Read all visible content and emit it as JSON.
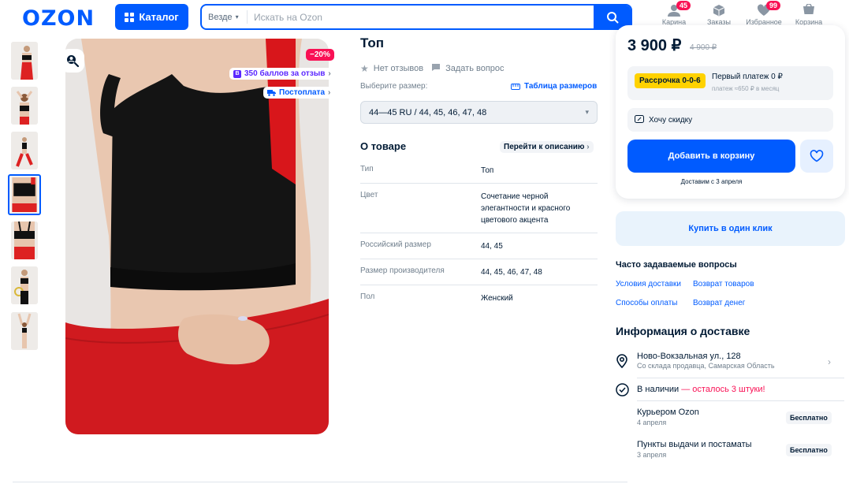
{
  "header": {
    "logo": "OZON",
    "catalog_label": "Каталог",
    "search": {
      "scope": "Везде",
      "placeholder": "Искать на Ozon"
    },
    "items": [
      {
        "label": "Карина",
        "icon": "user-icon",
        "badge": "45"
      },
      {
        "label": "Заказы",
        "icon": "box-icon",
        "badge": ""
      },
      {
        "label": "Избранное",
        "icon": "heart-icon",
        "badge": "99"
      },
      {
        "label": "Корзина",
        "icon": "cart-icon",
        "badge": ""
      }
    ]
  },
  "gallery": {
    "thumbnails": [
      "photo-1",
      "photo-2",
      "photo-3",
      "photo-4",
      "photo-5",
      "photo-6",
      "photo-7"
    ],
    "active_index": 3,
    "discount_badge": "−20%",
    "score_pill": "350 баллов за отзыв",
    "postpay_pill": "Постоплата"
  },
  "product": {
    "title": "Топ",
    "reviews": "Нет отзывов",
    "ask": "Задать вопрос",
    "size_label": "Выберите размер:",
    "size_table": "Таблица размеров",
    "size_selected": "44—45 RU / 44, 45, 46, 47, 48",
    "about_title": "О товаре",
    "to_description": "Перейти к описанию",
    "attributes": [
      {
        "key": "Тип",
        "value": "Топ"
      },
      {
        "key": "Цвет",
        "value": "Сочетание черной элегантности и красного цветового акцента"
      },
      {
        "key": "Российский размер",
        "value": "44, 45"
      },
      {
        "key": "Размер производителя",
        "value": "44, 45, 46, 47, 48"
      },
      {
        "key": "Пол",
        "value": "Женский"
      }
    ]
  },
  "buy": {
    "price": "3 900 ₽",
    "old_price": "4 900 ₽",
    "installment_tag": "Рассрочка 0-0-6",
    "installment_title": "Первый платеж 0 ₽",
    "installment_sub": "платеж ≈650 ₽ в месяц",
    "want_discount": "Хочу скидку",
    "add_to_cart": "Добавить в корзину",
    "delivery_date": "Доставим с 3 апреля",
    "one_click": "Купить в один клик"
  },
  "faq": {
    "title": "Часто задаваемые вопросы",
    "links": [
      "Условия доставки",
      "Возврат товаров",
      "Способы оплаты",
      "Возврат денег"
    ]
  },
  "delivery": {
    "title": "Информация о доставке",
    "address": "Ново-Вокзальная ул., 128",
    "address_sub": "Со склада продавца, Самарская Область",
    "stock_label": "В наличии",
    "stock_note": "— осталось 3 штуки!",
    "options": [
      {
        "name": "Курьером Ozon",
        "date": "4 апреля",
        "price": "Бесплатно"
      },
      {
        "name": "Пункты выдачи и постаматы",
        "date": "3 апреля",
        "price": "Бесплатно"
      }
    ]
  },
  "colors": {
    "accent": "#005bff",
    "sale": "#f91155",
    "installment": "#ffd200"
  }
}
